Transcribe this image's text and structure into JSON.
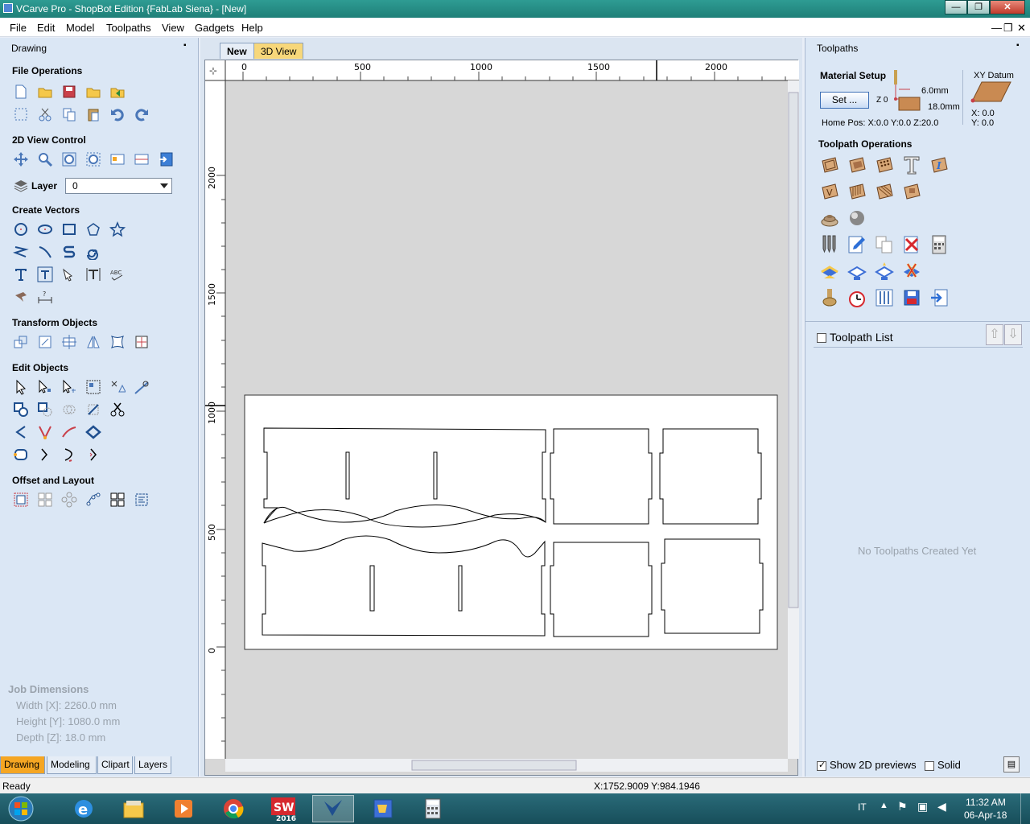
{
  "window": {
    "title": "VCarve Pro - ShopBot Edition {FabLab Siena} - [New]",
    "min": "—",
    "max": "❐",
    "close": "✕"
  },
  "menu": [
    "File",
    "Edit",
    "Model",
    "Toolpaths",
    "View",
    "Gadgets",
    "Help"
  ],
  "mdi_controls": {
    "min": "—",
    "restore": "❐",
    "close": "✕"
  },
  "left": {
    "header": "Drawing",
    "pin": "📌",
    "sections": {
      "file_ops": "File Operations",
      "view_ctrl": "2D View Control",
      "create_vectors": "Create Vectors",
      "transform": "Transform Objects",
      "edit": "Edit Objects",
      "offset": "Offset and Layout"
    },
    "layer_label": "Layer",
    "layer_value": "0",
    "job": {
      "title": "Job Dimensions",
      "width": "Width  [X]: 2260.0 mm",
      "height": "Height [Y]: 1080.0 mm",
      "depth": "Depth  [Z]: 18.0 mm"
    },
    "tabs": [
      "Drawing",
      "Modeling",
      "Clipart",
      "Layers"
    ]
  },
  "view_tabs": [
    "New",
    "3D View"
  ],
  "ruler_top": [
    "0",
    "500",
    "1000",
    "1500",
    "2000"
  ],
  "ruler_left": [
    "2000",
    "1500",
    "1000",
    "500",
    "0"
  ],
  "right": {
    "header": "Toolpaths",
    "material_setup": "Material Setup",
    "set_button": "Set ...",
    "thickness_top": "6.0mm",
    "thickness_bottom": "18.0mm",
    "z_zero": "Z 0",
    "xy_datum": "XY Datum",
    "datum_x": "X: 0.0",
    "datum_y": "Y: 0.0",
    "home_pos": "Home Pos:   X:0.0 Y:0.0 Z:20.0",
    "toolpath_ops": "Toolpath Operations",
    "toolpath_list": "Toolpath List",
    "no_toolpaths": "No Toolpaths Created Yet",
    "show_previews": "Show 2D previews",
    "solid": "Solid"
  },
  "status": {
    "left": "Ready",
    "coords": "X:1752.9009 Y:984.1946"
  },
  "taskbar": {
    "lang": "IT",
    "time": "11:32 AM",
    "date": "06-Apr-18",
    "sw_label": "2016"
  },
  "colors": {
    "accent_tab": "#f5a623",
    "panel_bg": "#dbe7f5",
    "title_bar": "#1f7f78"
  }
}
